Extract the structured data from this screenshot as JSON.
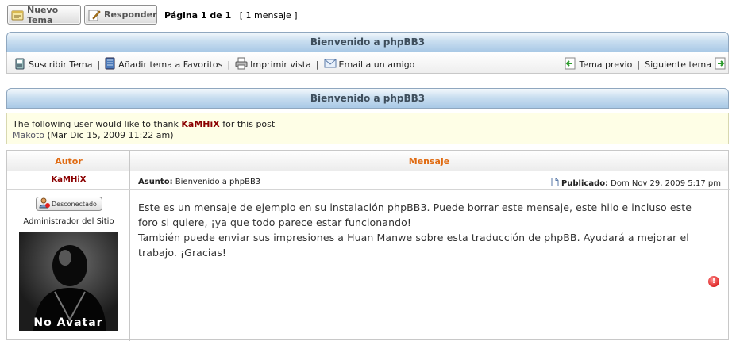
{
  "top": {
    "new_topic_label": "Nuevo Tema",
    "reply_label": "Responder",
    "pagination_prefix": "Página 1 de 1",
    "pagination_count": "[ 1 mensaje ]"
  },
  "topic": {
    "title": "Bienvenido a phpBB3",
    "tools": {
      "subscribe": "Suscribir Tema",
      "favorites": "Añadir tema a Favoritos",
      "print": "Imprimir vista",
      "email": "Email a un amigo",
      "prev": "Tema previo",
      "next": "Siguiente tema"
    }
  },
  "thanks": {
    "prefix": "The following user would like to thank",
    "user": "KaMHiX",
    "suffix": "for this post",
    "by_user": "Makoto",
    "by_date": "(Mar Dic 15, 2009 11:22 am)"
  },
  "post": {
    "author_header": "Autor",
    "message_header": "Mensaje",
    "author": "KaMHiX",
    "status": "Desconectado",
    "rank": "Administrador del Sitio",
    "avatar_text": "No Avatar",
    "subject_label": "Asunto:",
    "subject": "Bienvenido a phpBB3",
    "posted_label": "Publicado:",
    "posted_date": "Dom Nov 29, 2009 5:17 pm",
    "body_line1": "Este es un mensaje de ejemplo en su instalación phpBB3. Puede borrar este mensaje, este hilo e incluso este",
    "body_line2": "foro si quiere, ¡ya que todo parece estar funcionando!",
    "body_line3": "También puede enviar sus impresiones a Huan Manwe sobre esta traducción de phpBB. Ayudará a mejorar el",
    "body_line4": "trabajo. ¡Gracias!"
  }
}
